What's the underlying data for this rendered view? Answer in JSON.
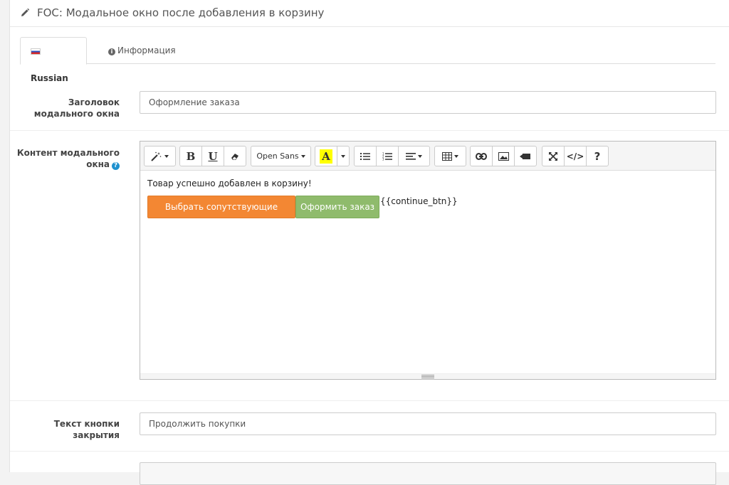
{
  "header": {
    "title": "FOC: Модальное окно после добавления в корзину",
    "icon": "pencil-icon"
  },
  "tabs": [
    {
      "label": "Russian",
      "icon": "flag-ru-icon",
      "active": true
    },
    {
      "label": "Информация",
      "icon": "info-circle-icon",
      "active": false
    }
  ],
  "form": {
    "modal_title": {
      "label": "Заголовок модального окна",
      "value": "Оформление заказа"
    },
    "modal_content": {
      "label": "Контент модального окна",
      "help_icon": "question-circle-icon",
      "toolbar": {
        "font_name": "Open Sans",
        "buttons": [
          "magic-icon",
          "bold-icon",
          "underline-icon",
          "eraser-icon",
          "font-dropdown",
          "highlight-color-icon",
          "color-dropdown-icon",
          "unordered-list-icon",
          "ordered-list-icon",
          "align-icon",
          "table-icon",
          "link-icon",
          "picture-icon",
          "video-icon",
          "fullscreen-icon",
          "code-view-icon",
          "help-icon"
        ],
        "bold_glyph": "B",
        "underline_glyph": "U",
        "color_glyph": "A",
        "help_glyph": "?",
        "code_glyph": "</>"
      },
      "content": {
        "text": "Товар успешно добавлен в корзину!",
        "button_primary": "Выбрать сопутствующие товары",
        "button_secondary": "Оформить заказ",
        "placeholder": "{{continue_btn}}"
      },
      "colors": {
        "orange": "#f38733",
        "green": "#8fbb6c",
        "highlight": "#ffff00"
      }
    },
    "close_button_text": {
      "label": "Текст кнопки закрытия",
      "value": "Продолжить покупки"
    }
  }
}
